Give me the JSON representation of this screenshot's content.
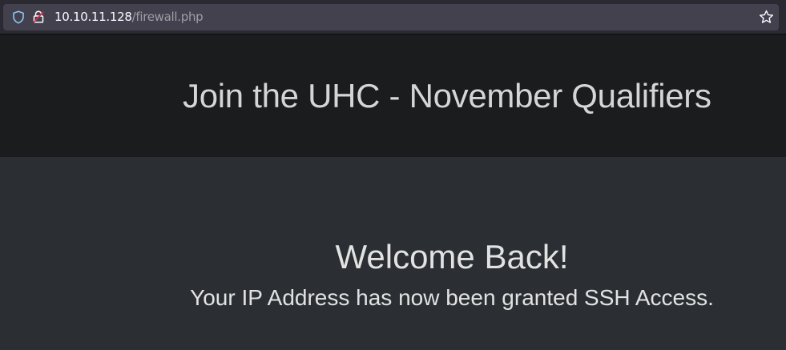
{
  "browser": {
    "url_host": "10.10.11.128",
    "url_path": "/firewall.php"
  },
  "header": {
    "title": "Join the UHC - November Qualifiers"
  },
  "main": {
    "heading": "Welcome Back!",
    "message": "Your IP Address has now been granted SSH Access."
  },
  "icons": {
    "tracking_protection": "shield-icon",
    "connection": "insecure-lock-icon",
    "bookmark": "star-icon"
  },
  "colors": {
    "header_bg": "#1b1c1e",
    "main_bg": "#2b2f33",
    "urlbar_bg": "#42414d",
    "text": "#e2e2e2"
  }
}
